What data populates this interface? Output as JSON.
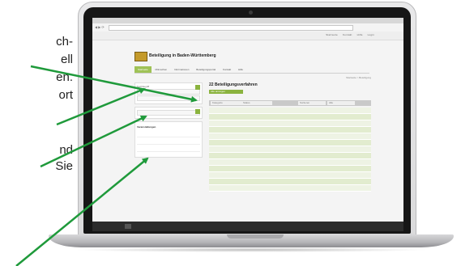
{
  "left_text": {
    "line1": "ch-",
    "line2": "ell",
    "line3": "en.",
    "line4": "ort",
    "line5": "nd",
    "line6": "Sie"
  },
  "site": {
    "title": "Beteiligung in Baden-Württemberg",
    "top_links": [
      "Startseite",
      "Kontakt",
      "Hilfe",
      "Login"
    ],
    "nav": [
      "Startseite",
      "Mitmachen",
      "Informationen",
      "Beteiligungsportal",
      "Kontakt",
      "Hilfe"
    ],
    "breadcrumb": "Startseite > Beteiligung",
    "main_title": "22 Beteiligungsverfahren",
    "main_subtitle": "",
    "action_button": "Alle anzeigen",
    "filters": [
      "Kategorie",
      "Status",
      "Sortieren",
      "Alle"
    ],
    "rows": [
      {
        "name": "",
        "date": ""
      },
      {
        "name": "",
        "date": ""
      },
      {
        "name": "",
        "date": ""
      },
      {
        "name": "",
        "date": ""
      },
      {
        "name": "",
        "date": ""
      },
      {
        "name": "",
        "date": ""
      },
      {
        "name": "",
        "date": ""
      },
      {
        "name": "",
        "date": ""
      },
      {
        "name": "",
        "date": ""
      },
      {
        "name": "",
        "date": ""
      },
      {
        "name": "",
        "date": ""
      },
      {
        "name": "",
        "date": ""
      },
      {
        "name": "",
        "date": ""
      }
    ],
    "sidebar": {
      "search_label": "Suchbegriff",
      "field1": "",
      "field2": "",
      "field3": "",
      "section_head": "Veranstaltungen",
      "items": [
        "",
        "",
        ""
      ],
      "text": ""
    },
    "footer": [
      "",
      "",
      ""
    ]
  },
  "colors": {
    "accent_green": "#8bb33f",
    "arrow_green": "#1f9a3b",
    "bezel": "#161616",
    "body_silver": "#e0e0e2"
  }
}
